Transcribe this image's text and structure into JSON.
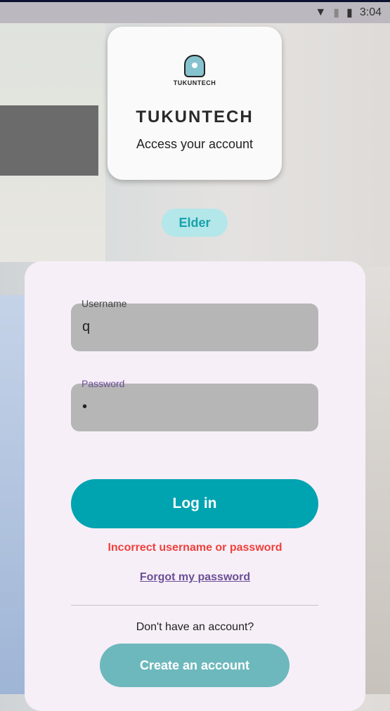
{
  "status_bar": {
    "time": "3:04"
  },
  "header": {
    "logo_text": "TUKUNTECH",
    "brand": "TUKUNTECH",
    "subtitle": "Access your account"
  },
  "role_chip": "Elder",
  "form": {
    "username": {
      "label": "Username",
      "value": "q"
    },
    "password": {
      "label": "Password",
      "value": "•"
    },
    "login_label": "Log in",
    "error": "Incorrect username or password",
    "forgot": "Forgot my password",
    "no_account": "Don't have an account?",
    "create_label": "Create an account"
  },
  "colors": {
    "accent": "#00a3b0",
    "error": "#f0403a",
    "link": "#6c4f96",
    "chip_bg": "#b3e7ea"
  }
}
